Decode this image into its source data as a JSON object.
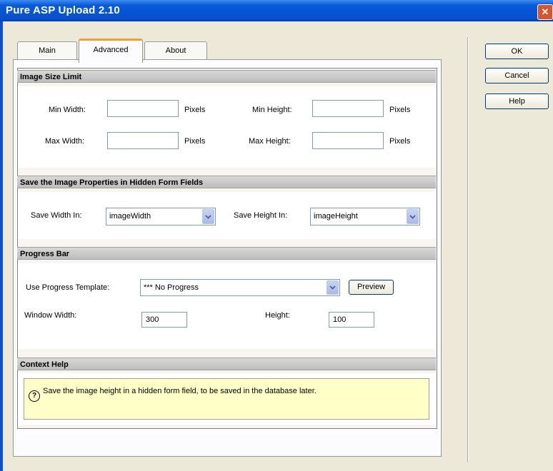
{
  "window": {
    "title": "Pure ASP Upload 2.10",
    "close_glyph": "✕"
  },
  "tabs": [
    {
      "label": "Main",
      "active": false
    },
    {
      "label": "Advanced",
      "active": true
    },
    {
      "label": "About",
      "active": false
    }
  ],
  "buttons": {
    "ok": "OK",
    "cancel": "Cancel",
    "help": "Help",
    "preview": "Preview"
  },
  "image_size": {
    "header": "Image Size Limit",
    "min_width_label": "Min Width:",
    "min_height_label": "Min Height:",
    "max_width_label": "Max Width:",
    "max_height_label": "Max Height:",
    "pixels": "Pixels",
    "min_width_value": "",
    "min_height_value": "",
    "max_width_value": "",
    "max_height_value": ""
  },
  "hidden_fields": {
    "header": "Save the Image Properties in Hidden Form Fields",
    "save_width_label": "Save Width In:",
    "save_width_value": "imageWidth",
    "save_height_label": "Save Height In:",
    "save_height_value": "imageHeight"
  },
  "progress": {
    "header": "Progress Bar",
    "template_label": "Use Progress Template:",
    "template_value": "*** No Progress",
    "window_width_label": "Window Width:",
    "window_width_value": "300",
    "height_label": "Height:",
    "height_value": "100"
  },
  "context_help": {
    "header": "Context Help",
    "icon_glyph": "?",
    "text": "Save the image height in a hidden form field, to be saved in the database later."
  },
  "colors": {
    "titlebar": "#0554d8",
    "tab_accent": "#f0a030",
    "help_bg": "#ffffc8",
    "close": "#d8542c"
  }
}
